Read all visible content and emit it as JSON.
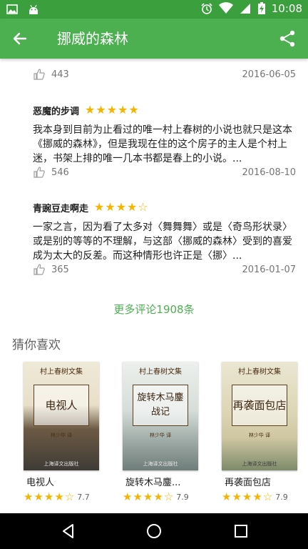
{
  "status_bar": {
    "time": "10:08",
    "icons_left": [
      "image-icon",
      "android-icon"
    ],
    "icons_right": [
      "alarm-icon",
      "wifi-icon",
      "signal-icon",
      "battery-charging-icon"
    ]
  },
  "app_bar": {
    "title": "挪威的森林",
    "color": "#4caf50",
    "status_color": "#3a9f3c"
  },
  "top_meta": {
    "likes": "443",
    "date": "2016-06-05"
  },
  "reviews": [
    {
      "user": "恶魔的步调",
      "rating": 5,
      "text": "我本身到目前为止看过的唯一村上春树的小说也就只是这本《挪威的森林》，但是我现在住的这个房子的主人是个村上迷，书架上排的唯一几本书都是春上的小说。...",
      "likes": "546",
      "date": "2016-08-10"
    },
    {
      "user": "青豌豆走啊走",
      "rating": 4,
      "text": "一家之言，因为看了太多对〈舞舞舞〉或是〈奇鸟形状录〉或是别的等等的不理解，与这部〈挪威的森林〉受到的喜爱成为太大的反差。而这种情形也许正是〈挪〉...",
      "likes": "365",
      "date": "2016-01-07"
    }
  ],
  "more_reviews": "更多评论1908条",
  "recommend": {
    "section_title": "猜你喜欢",
    "books": [
      {
        "title": "电视人",
        "display_title": "电视人",
        "cover_series": "村上春树文集",
        "cover_name": "电视人",
        "cover_translator": "林少华 译",
        "cover_publisher": "上海译文出版社",
        "rating": 4,
        "score": "7.7",
        "cover_color": "#8a7a5c"
      },
      {
        "title": "旋转木马鏖战记",
        "display_title": "旋转木马鏖...",
        "cover_series": "村上春树文集",
        "cover_name": "旋转木马鏖战记",
        "cover_translator": "林少华 译",
        "cover_publisher": "上海译文出版社",
        "rating": 4,
        "score": "7.9",
        "cover_color": "#a7b3b0"
      },
      {
        "title": "再袭面包店",
        "display_title": "再袭面包店",
        "cover_series": "村上春树文集",
        "cover_name": "再袭面包店",
        "cover_translator": "林少华 译",
        "cover_publisher": "上海译文出版社",
        "rating": 4,
        "score": "7.9",
        "cover_color": "#c9c2a0"
      }
    ]
  },
  "nav_bar": {
    "buttons": [
      "back-triangle-icon",
      "home-circle-icon",
      "recents-square-icon"
    ]
  }
}
